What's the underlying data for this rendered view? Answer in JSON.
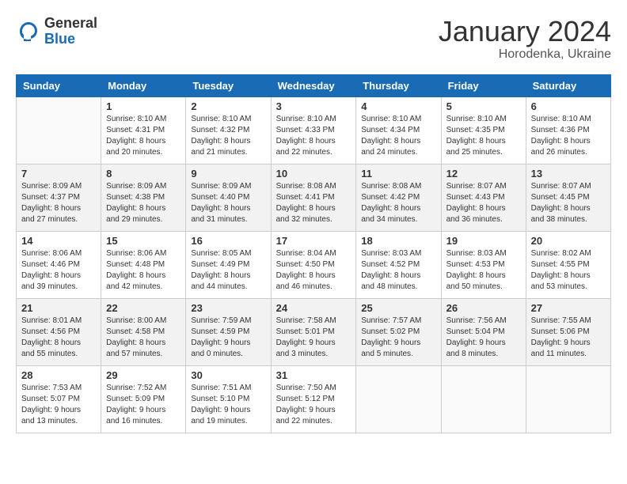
{
  "logo": {
    "general": "General",
    "blue": "Blue"
  },
  "title": "January 2024",
  "location": "Horodenka, Ukraine",
  "days_header": [
    "Sunday",
    "Monday",
    "Tuesday",
    "Wednesday",
    "Thursday",
    "Friday",
    "Saturday"
  ],
  "weeks": [
    [
      {
        "num": "",
        "info": ""
      },
      {
        "num": "1",
        "info": "Sunrise: 8:10 AM\nSunset: 4:31 PM\nDaylight: 8 hours\nand 20 minutes."
      },
      {
        "num": "2",
        "info": "Sunrise: 8:10 AM\nSunset: 4:32 PM\nDaylight: 8 hours\nand 21 minutes."
      },
      {
        "num": "3",
        "info": "Sunrise: 8:10 AM\nSunset: 4:33 PM\nDaylight: 8 hours\nand 22 minutes."
      },
      {
        "num": "4",
        "info": "Sunrise: 8:10 AM\nSunset: 4:34 PM\nDaylight: 8 hours\nand 24 minutes."
      },
      {
        "num": "5",
        "info": "Sunrise: 8:10 AM\nSunset: 4:35 PM\nDaylight: 8 hours\nand 25 minutes."
      },
      {
        "num": "6",
        "info": "Sunrise: 8:10 AM\nSunset: 4:36 PM\nDaylight: 8 hours\nand 26 minutes."
      }
    ],
    [
      {
        "num": "7",
        "info": "Sunrise: 8:09 AM\nSunset: 4:37 PM\nDaylight: 8 hours\nand 27 minutes."
      },
      {
        "num": "8",
        "info": "Sunrise: 8:09 AM\nSunset: 4:38 PM\nDaylight: 8 hours\nand 29 minutes."
      },
      {
        "num": "9",
        "info": "Sunrise: 8:09 AM\nSunset: 4:40 PM\nDaylight: 8 hours\nand 31 minutes."
      },
      {
        "num": "10",
        "info": "Sunrise: 8:08 AM\nSunset: 4:41 PM\nDaylight: 8 hours\nand 32 minutes."
      },
      {
        "num": "11",
        "info": "Sunrise: 8:08 AM\nSunset: 4:42 PM\nDaylight: 8 hours\nand 34 minutes."
      },
      {
        "num": "12",
        "info": "Sunrise: 8:07 AM\nSunset: 4:43 PM\nDaylight: 8 hours\nand 36 minutes."
      },
      {
        "num": "13",
        "info": "Sunrise: 8:07 AM\nSunset: 4:45 PM\nDaylight: 8 hours\nand 38 minutes."
      }
    ],
    [
      {
        "num": "14",
        "info": "Sunrise: 8:06 AM\nSunset: 4:46 PM\nDaylight: 8 hours\nand 39 minutes."
      },
      {
        "num": "15",
        "info": "Sunrise: 8:06 AM\nSunset: 4:48 PM\nDaylight: 8 hours\nand 42 minutes."
      },
      {
        "num": "16",
        "info": "Sunrise: 8:05 AM\nSunset: 4:49 PM\nDaylight: 8 hours\nand 44 minutes."
      },
      {
        "num": "17",
        "info": "Sunrise: 8:04 AM\nSunset: 4:50 PM\nDaylight: 8 hours\nand 46 minutes."
      },
      {
        "num": "18",
        "info": "Sunrise: 8:03 AM\nSunset: 4:52 PM\nDaylight: 8 hours\nand 48 minutes."
      },
      {
        "num": "19",
        "info": "Sunrise: 8:03 AM\nSunset: 4:53 PM\nDaylight: 8 hours\nand 50 minutes."
      },
      {
        "num": "20",
        "info": "Sunrise: 8:02 AM\nSunset: 4:55 PM\nDaylight: 8 hours\nand 53 minutes."
      }
    ],
    [
      {
        "num": "21",
        "info": "Sunrise: 8:01 AM\nSunset: 4:56 PM\nDaylight: 8 hours\nand 55 minutes."
      },
      {
        "num": "22",
        "info": "Sunrise: 8:00 AM\nSunset: 4:58 PM\nDaylight: 8 hours\nand 57 minutes."
      },
      {
        "num": "23",
        "info": "Sunrise: 7:59 AM\nSunset: 4:59 PM\nDaylight: 9 hours\nand 0 minutes."
      },
      {
        "num": "24",
        "info": "Sunrise: 7:58 AM\nSunset: 5:01 PM\nDaylight: 9 hours\nand 3 minutes."
      },
      {
        "num": "25",
        "info": "Sunrise: 7:57 AM\nSunset: 5:02 PM\nDaylight: 9 hours\nand 5 minutes."
      },
      {
        "num": "26",
        "info": "Sunrise: 7:56 AM\nSunset: 5:04 PM\nDaylight: 9 hours\nand 8 minutes."
      },
      {
        "num": "27",
        "info": "Sunrise: 7:55 AM\nSunset: 5:06 PM\nDaylight: 9 hours\nand 11 minutes."
      }
    ],
    [
      {
        "num": "28",
        "info": "Sunrise: 7:53 AM\nSunset: 5:07 PM\nDaylight: 9 hours\nand 13 minutes."
      },
      {
        "num": "29",
        "info": "Sunrise: 7:52 AM\nSunset: 5:09 PM\nDaylight: 9 hours\nand 16 minutes."
      },
      {
        "num": "30",
        "info": "Sunrise: 7:51 AM\nSunset: 5:10 PM\nDaylight: 9 hours\nand 19 minutes."
      },
      {
        "num": "31",
        "info": "Sunrise: 7:50 AM\nSunset: 5:12 PM\nDaylight: 9 hours\nand 22 minutes."
      },
      {
        "num": "",
        "info": ""
      },
      {
        "num": "",
        "info": ""
      },
      {
        "num": "",
        "info": ""
      }
    ]
  ]
}
